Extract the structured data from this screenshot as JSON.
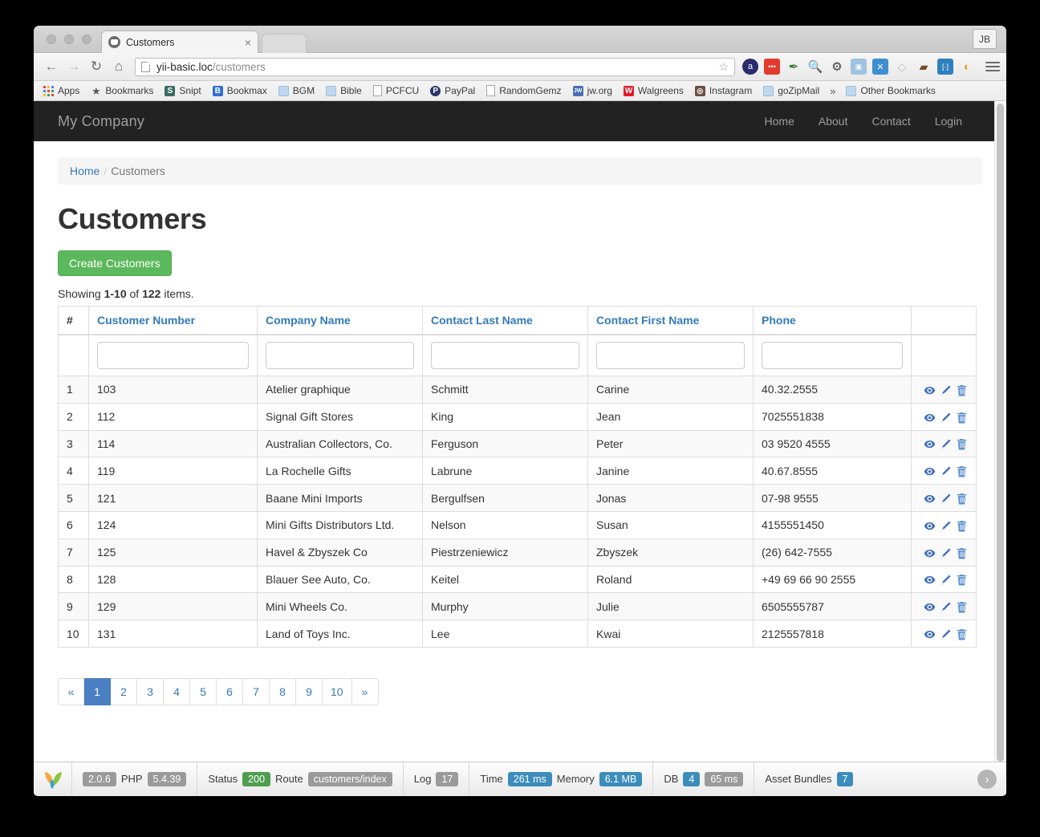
{
  "browser": {
    "tab_title": "Customers",
    "tab_close": "×",
    "profile_initials": "JB",
    "back_icon": "←",
    "forward_icon": "→",
    "reload_icon": "↻",
    "home_icon": "⌂",
    "url_host": "yii-basic.loc",
    "url_path": "/customers",
    "star_icon": "☆",
    "menu_icon": "hamburger-menu-icon",
    "extensions": [
      {
        "name": "amazon-assistant-icon",
        "glyph": "a",
        "color": "#2b2b6e"
      },
      {
        "name": "adblock-icon",
        "glyph": "•••",
        "color": "#e23b2e"
      },
      {
        "name": "eyedropper-icon",
        "glyph": "✐",
        "color": "#3a7a3a"
      },
      {
        "name": "magnifier-icon",
        "glyph": "○",
        "color": "#8a8a8a"
      },
      {
        "name": "gear-icon",
        "glyph": "⚙",
        "color": "#3d3d3d"
      },
      {
        "name": "camera-icon",
        "glyph": "■",
        "color": "#9fc3e0"
      },
      {
        "name": "xmarks-icon",
        "glyph": "✕",
        "color": "#3d8fd1"
      },
      {
        "name": "tag-icon",
        "glyph": "◇",
        "color": "#c2c2c2"
      },
      {
        "name": "incognito-mask-icon",
        "glyph": "▬",
        "color": "#7a4a2a"
      },
      {
        "name": "bracket-icon",
        "glyph": "⌨",
        "color": "#2f7fbd"
      },
      {
        "name": "sunrise-icon",
        "glyph": "◑",
        "color": "#e8a33d"
      }
    ],
    "bookmarks": [
      {
        "label": "Apps",
        "icon": "apps-grid-icon",
        "type": "apps"
      },
      {
        "label": "Bookmarks",
        "icon": "star-icon",
        "type": "star"
      },
      {
        "label": "Snipt",
        "icon": "snipt-icon",
        "type": "sq",
        "glyph": "S",
        "color": "#3d6b63"
      },
      {
        "label": "Bookmax",
        "icon": "bookmax-icon",
        "type": "sq",
        "glyph": "B",
        "color": "#2f6fd0"
      },
      {
        "label": "BGM",
        "icon": "folder-icon",
        "type": "folder"
      },
      {
        "label": "Bible",
        "icon": "folder-icon",
        "type": "folder"
      },
      {
        "label": "PCFCU",
        "icon": "page-icon",
        "type": "file"
      },
      {
        "label": "PayPal",
        "icon": "paypal-icon",
        "type": "sq",
        "glyph": "P",
        "color": "#28356a"
      },
      {
        "label": "RandomGemz",
        "icon": "page-icon",
        "type": "file"
      },
      {
        "label": "jw.org",
        "icon": "jw-icon",
        "type": "sq",
        "glyph": "JW",
        "color": "#4a6fae"
      },
      {
        "label": "Walgreens",
        "icon": "walgreens-icon",
        "type": "sq",
        "glyph": "W",
        "color": "#e01a2b"
      },
      {
        "label": "Instagram",
        "icon": "instagram-icon",
        "type": "sq",
        "glyph": "◎",
        "color": "#6b5042"
      },
      {
        "label": "goZipMail",
        "icon": "folder-icon",
        "type": "folder"
      }
    ],
    "overflow_chevrons": "»",
    "other_bookmarks": {
      "label": "Other Bookmarks",
      "icon": "folder-icon"
    }
  },
  "site": {
    "brand": "My Company",
    "nav": [
      {
        "label": "Home"
      },
      {
        "label": "About"
      },
      {
        "label": "Contact"
      },
      {
        "label": "Login"
      }
    ],
    "breadcrumb": {
      "home": "Home",
      "separator": "/",
      "current": "Customers"
    },
    "page_title": "Customers",
    "create_button": "Create Customers",
    "summary": {
      "prefix": "Showing ",
      "range": "1-10",
      "middle": " of ",
      "total": "122",
      "suffix": " items."
    }
  },
  "grid": {
    "columns": [
      {
        "key": "num",
        "label": "#"
      },
      {
        "key": "customer_number",
        "label": "Customer Number"
      },
      {
        "key": "company_name",
        "label": "Company Name"
      },
      {
        "key": "contact_last_name",
        "label": "Contact Last Name"
      },
      {
        "key": "contact_first_name",
        "label": "Contact First Name"
      },
      {
        "key": "phone",
        "label": "Phone"
      },
      {
        "key": "actions",
        "label": ""
      }
    ],
    "filters": [
      {
        "name": "filter-customer-number",
        "value": "",
        "placeholder": ""
      },
      {
        "name": "filter-company-name",
        "value": "",
        "placeholder": ""
      },
      {
        "name": "filter-contact-last-name",
        "value": "",
        "placeholder": ""
      },
      {
        "name": "filter-contact-first-name",
        "value": "",
        "placeholder": ""
      },
      {
        "name": "filter-phone",
        "value": "",
        "placeholder": ""
      }
    ],
    "action_icons": [
      "view-eye-icon",
      "update-pencil-icon",
      "delete-trash-icon"
    ],
    "rows": [
      {
        "num": "1",
        "customer_number": "103",
        "company_name": "Atelier graphique",
        "contact_last_name": "Schmitt",
        "contact_first_name": "Carine",
        "phone": "40.32.2555"
      },
      {
        "num": "2",
        "customer_number": "112",
        "company_name": "Signal Gift Stores",
        "contact_last_name": "King",
        "contact_first_name": "Jean",
        "phone": "7025551838"
      },
      {
        "num": "3",
        "customer_number": "114",
        "company_name": "Australian Collectors, Co.",
        "contact_last_name": "Ferguson",
        "contact_first_name": "Peter",
        "phone": "03 9520 4555"
      },
      {
        "num": "4",
        "customer_number": "119",
        "company_name": "La Rochelle Gifts",
        "contact_last_name": "Labrune",
        "contact_first_name": "Janine",
        "phone": "40.67.8555"
      },
      {
        "num": "5",
        "customer_number": "121",
        "company_name": "Baane Mini Imports",
        "contact_last_name": "Bergulfsen",
        "contact_first_name": "Jonas",
        "phone": "07-98 9555"
      },
      {
        "num": "6",
        "customer_number": "124",
        "company_name": "Mini Gifts Distributors Ltd.",
        "contact_last_name": "Nelson",
        "contact_first_name": "Susan",
        "phone": "4155551450"
      },
      {
        "num": "7",
        "customer_number": "125",
        "company_name": "Havel & Zbyszek Co",
        "contact_last_name": "Piestrzeniewicz",
        "contact_first_name": "Zbyszek",
        "phone": "(26) 642-7555"
      },
      {
        "num": "8",
        "customer_number": "128",
        "company_name": "Blauer See Auto, Co.",
        "contact_last_name": "Keitel",
        "contact_first_name": "Roland",
        "phone": "+49 69 66 90 2555"
      },
      {
        "num": "9",
        "customer_number": "129",
        "company_name": "Mini Wheels Co.",
        "contact_last_name": "Murphy",
        "contact_first_name": "Julie",
        "phone": "6505555787"
      },
      {
        "num": "10",
        "customer_number": "131",
        "company_name": "Land of Toys Inc.",
        "contact_last_name": "Lee",
        "contact_first_name": "Kwai",
        "phone": "2125557818"
      }
    ]
  },
  "pagination": {
    "prev": "«",
    "next": "»",
    "pages": [
      "1",
      "2",
      "3",
      "4",
      "5",
      "6",
      "7",
      "8",
      "9",
      "10"
    ],
    "active": "1"
  },
  "debug_toolbar": {
    "logo": "yii-logo-icon",
    "version": "2.0.6",
    "php_label": "PHP",
    "php_version": "5.4.39",
    "status_label": "Status",
    "status_value": "200",
    "route_label": "Route",
    "route_value": "customers/index",
    "log_label": "Log",
    "log_value": "17",
    "time_label": "Time",
    "time_value": "261 ms",
    "memory_label": "Memory",
    "memory_value": "6.1 MB",
    "db_label": "DB",
    "db_count": "4",
    "db_time": "65 ms",
    "asset_label": "Asset Bundles",
    "asset_value": "7",
    "toggle_icon": "›"
  },
  "colors": {
    "navbar_bg": "#222222",
    "link_blue": "#337ab7",
    "create_green": "#5cb85c",
    "pager_active": "#4a7fc1",
    "status_green": "#4f9e4f",
    "pill_blue": "#3c8dbc",
    "pill_grey": "#9a9a9a"
  }
}
